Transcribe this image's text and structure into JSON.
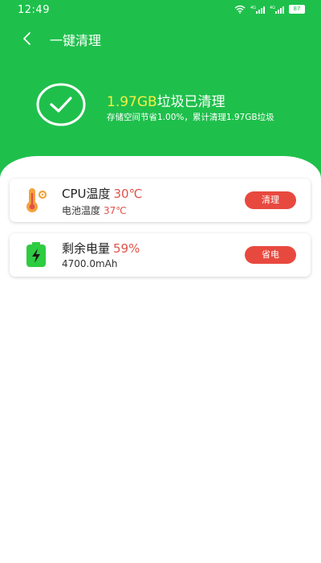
{
  "status_bar": {
    "time": "12:49",
    "network_1": "4G",
    "network_2": "4G",
    "battery": "87"
  },
  "toolbar": {
    "title": "一键清理"
  },
  "summary": {
    "amount": "1.97GB",
    "headline_suffix": "垃圾已清理",
    "subtitle": "存储空间节省1.00%，累计清理1.97GB垃圾"
  },
  "cards": [
    {
      "title": "CPU温度",
      "title_value": "30℃",
      "sub_label": "电池温度",
      "sub_value": "37℃",
      "button_label": "清理",
      "icon": "thermometer-icon"
    },
    {
      "title": "剩余电量",
      "title_value": "59%",
      "sub_label": "4700.0mAh",
      "button_label": "省电",
      "icon": "battery-charging-icon"
    }
  ],
  "colors": {
    "brand_green": "#1ec04b",
    "highlight_yellow": "#f5f044",
    "accent_red": "#e8493f",
    "value_red": "#e0524a"
  }
}
